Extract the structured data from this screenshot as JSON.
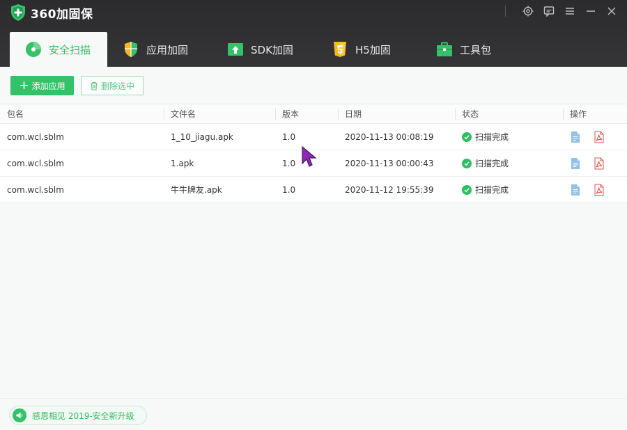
{
  "app": {
    "title": "360加固保",
    "window_controls": [
      "settings-icon",
      "feedback-icon",
      "menu-icon",
      "minimize-icon",
      "close-icon"
    ]
  },
  "tabs": [
    {
      "label": "安全扫描",
      "icon": "scan-icon",
      "active": true
    },
    {
      "label": "应用加固",
      "icon": "shield-icon",
      "active": false
    },
    {
      "label": "SDK加固",
      "icon": "sdk-upload-icon",
      "active": false
    },
    {
      "label": "H5加固",
      "icon": "html5-icon",
      "active": false
    },
    {
      "label": "工具包",
      "icon": "toolbox-icon",
      "active": false
    }
  ],
  "toolbar": {
    "add_label": "添加应用",
    "delete_label": "删除选中"
  },
  "table": {
    "columns": [
      "包名",
      "文件名",
      "版本",
      "日期",
      "状态",
      "操作"
    ],
    "rows": [
      {
        "package": "com.wcl.sblm",
        "file": "1_10_jiagu.apk",
        "version": "1.0",
        "date": "2020-11-13 00:08:19",
        "status": "扫描完成"
      },
      {
        "package": "com.wcl.sblm",
        "file": "1.apk",
        "version": "1.0",
        "date": "2020-11-13 00:00:43",
        "status": "扫描完成"
      },
      {
        "package": "com.wcl.sblm",
        "file": "牛牛牌友.apk",
        "version": "1.0",
        "date": "2020-11-12 19:55:39",
        "status": "扫描完成"
      }
    ]
  },
  "footer": {
    "notice": "感恩相见 2019-安全新升级"
  },
  "colors": {
    "accent": "#34c167",
    "header_bg": "#2d2d2f",
    "pdf_red": "#e4534b",
    "doc_blue": "#8fc1ea"
  }
}
